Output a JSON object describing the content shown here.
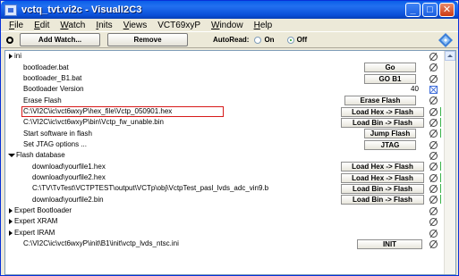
{
  "window": {
    "title": "vctq_tvt.vi2c - VisualI2C3"
  },
  "menu": [
    {
      "label": "File",
      "ul": "F",
      "rest": "ile"
    },
    {
      "label": "Edit",
      "ul": "E",
      "rest": "dit"
    },
    {
      "label": "Watch",
      "ul": "W",
      "rest": "atch"
    },
    {
      "label": "Inits",
      "ul": "I",
      "rest": "nits"
    },
    {
      "label": "Views",
      "ul": "V",
      "rest": "iews"
    },
    {
      "label": "VCT69xyP",
      "ul": "",
      "rest": "VCT69xyP"
    },
    {
      "label": "Window",
      "ul": "W",
      "rest": "indow"
    },
    {
      "label": "Help",
      "ul": "H",
      "rest": "elp"
    }
  ],
  "toolbar": {
    "add_watch": "Add Watch...",
    "remove": "Remove",
    "autoread_label": "AutoRead:",
    "on_label": "On",
    "off_label": "Off",
    "autoread_selected": "Off"
  },
  "rows": [
    {
      "label": "ini",
      "indent": 0,
      "expander": "collapsed",
      "button": "",
      "status": "null",
      "value": ""
    },
    {
      "label": "bootloader.bat",
      "indent": 1,
      "expander": "",
      "button": "Go",
      "status": "null",
      "value": ""
    },
    {
      "label": "bootloader_B1.bat",
      "indent": 1,
      "expander": "",
      "button": "GO B1",
      "status": "null",
      "value": ""
    },
    {
      "label": "Bootloader Version",
      "indent": 1,
      "expander": "",
      "button": "",
      "status": "check",
      "value": "40"
    },
    {
      "label": "Erase Flash",
      "indent": 1,
      "expander": "",
      "button": "Erase Flash",
      "status": "null",
      "value": ""
    },
    {
      "label": "C:\\VI2C\\ic\\vct6wxyP\\hex_file\\Vctp_050901.hex",
      "indent": 1,
      "expander": "",
      "button": "Load Hex -> Flash",
      "status": "null-green",
      "value": "",
      "highlighted": true
    },
    {
      "label": "C:\\VI2C\\ic\\vct6wxyP\\bin\\Vctp_fw_unable.bin",
      "indent": 1,
      "expander": "",
      "button": "Load Bin -> Flash",
      "status": "null-green",
      "value": ""
    },
    {
      "label": "Start software in flash",
      "indent": 1,
      "expander": "",
      "button": "Jump Flash",
      "status": "null-green",
      "value": ""
    },
    {
      "label": "Set JTAG options ...",
      "indent": 1,
      "expander": "",
      "button": "JTAG",
      "status": "null",
      "value": ""
    },
    {
      "label": "Flash database",
      "indent": 0,
      "expander": "expanded",
      "button": "",
      "status": "null",
      "value": ""
    },
    {
      "label": "download\\yourfile1.hex",
      "indent": 2,
      "expander": "",
      "button": "Load Hex -> Flash",
      "status": "null-green",
      "value": ""
    },
    {
      "label": "download\\yourfile2.hex",
      "indent": 2,
      "expander": "",
      "button": "Load Hex -> Flash",
      "status": "null-green",
      "value": ""
    },
    {
      "label": "C:\\TV\\TvTest\\VCTPTEST\\output\\VCTp\\obj\\VctpTest_pasl_lvds_adc_vin9.b",
      "indent": 2,
      "expander": "",
      "button": "Load Bin -> Flash",
      "status": "null-green",
      "value": ""
    },
    {
      "label": "download\\yourfile2.bin",
      "indent": 2,
      "expander": "",
      "button": "Load Bin -> Flash",
      "status": "null-green",
      "value": ""
    },
    {
      "label": "Expert Bootloader",
      "indent": 0,
      "expander": "collapsed",
      "button": "",
      "status": "null",
      "value": ""
    },
    {
      "label": "Expert XRAM",
      "indent": 0,
      "expander": "collapsed",
      "button": "",
      "status": "null",
      "value": ""
    },
    {
      "label": "Expert IRAM",
      "indent": 0,
      "expander": "collapsed",
      "button": "",
      "status": "null",
      "value": ""
    },
    {
      "label": "C:\\VI2C\\ic\\vct6wxyP\\init\\B1\\init\\vctp_lvds_ntsc.ini",
      "indent": 1,
      "expander": "",
      "button": "INIT",
      "status": "null",
      "value": ""
    }
  ],
  "colors": {
    "title_bar": "#0a5fe8",
    "highlight_border": "#d71919",
    "status_green": "#3bb34a"
  }
}
